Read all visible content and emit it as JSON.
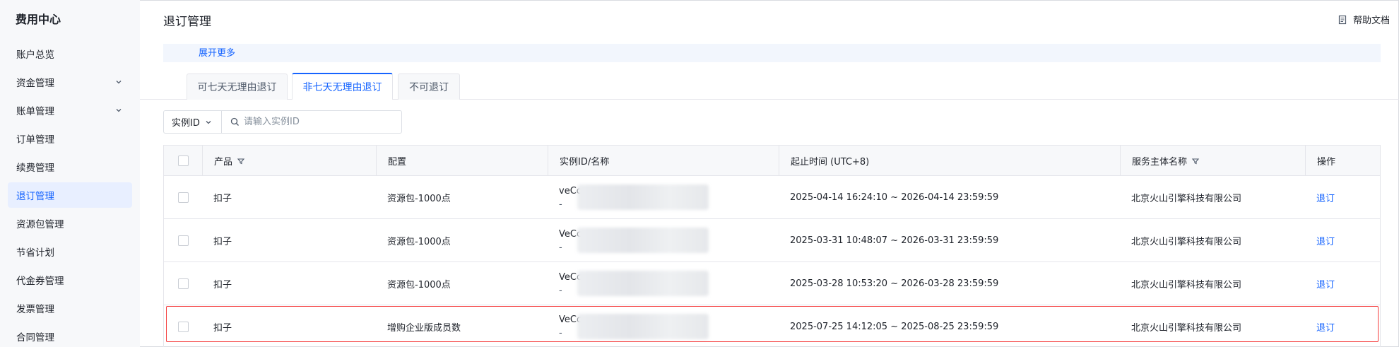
{
  "sidebar": {
    "title": "费用中心",
    "items": [
      {
        "label": "账户总览",
        "chevron": false,
        "active": false
      },
      {
        "label": "资金管理",
        "chevron": true,
        "active": false
      },
      {
        "label": "账单管理",
        "chevron": true,
        "active": false
      },
      {
        "label": "订单管理",
        "chevron": false,
        "active": false
      },
      {
        "label": "续费管理",
        "chevron": false,
        "active": false
      },
      {
        "label": "退订管理",
        "chevron": false,
        "active": true
      },
      {
        "label": "资源包管理",
        "chevron": false,
        "active": false
      },
      {
        "label": "节省计划",
        "chevron": false,
        "active": false
      },
      {
        "label": "代金券管理",
        "chevron": false,
        "active": false
      },
      {
        "label": "发票管理",
        "chevron": false,
        "active": false
      },
      {
        "label": "合同管理",
        "chevron": false,
        "active": false
      }
    ]
  },
  "header": {
    "title": "退订管理",
    "help_label": "帮助文档"
  },
  "notice": {
    "more_label": "展开更多"
  },
  "tabs": [
    {
      "label": "可七天无理由退订",
      "active": false
    },
    {
      "label": "非七天无理由退订",
      "active": true
    },
    {
      "label": "不可退订",
      "active": false
    }
  ],
  "filter": {
    "select_label": "实例ID",
    "search_placeholder": "请输入实例ID"
  },
  "table": {
    "columns": [
      "产品",
      "配置",
      "实例ID/名称",
      "起止时间 (UTC+8)",
      "服务主体名称",
      "操作"
    ],
    "rows": [
      {
        "product": "扣子",
        "config": "资源包-1000点",
        "instance_id": "veCc",
        "instance_name": "-",
        "period": "2025-04-14 16:24:10 ~ 2026-04-14 23:59:59",
        "entity": "北京火山引擎科技有限公司",
        "action": "退订"
      },
      {
        "product": "扣子",
        "config": "资源包-1000点",
        "instance_id": "VeCc",
        "instance_name": "-",
        "period": "2025-03-31 10:48:07 ~ 2026-03-31 23:59:59",
        "entity": "北京火山引擎科技有限公司",
        "action": "退订"
      },
      {
        "product": "扣子",
        "config": "资源包-1000点",
        "instance_id": "VeCc",
        "instance_name": "-",
        "period": "2025-03-28 10:53:20 ~ 2026-03-28 23:59:59",
        "entity": "北京火山引擎科技有限公司",
        "action": "退订"
      },
      {
        "product": "扣子",
        "config": "增购企业版成员数",
        "instance_id": "VeCc",
        "instance_name": "-",
        "period": "2025-07-25 14:12:05 ~ 2025-08-25 23:59:59",
        "entity": "北京火山引擎科技有限公司",
        "action": "退订"
      }
    ]
  },
  "colors": {
    "accent": "#1664ff",
    "highlight_border": "#f53f3f"
  }
}
